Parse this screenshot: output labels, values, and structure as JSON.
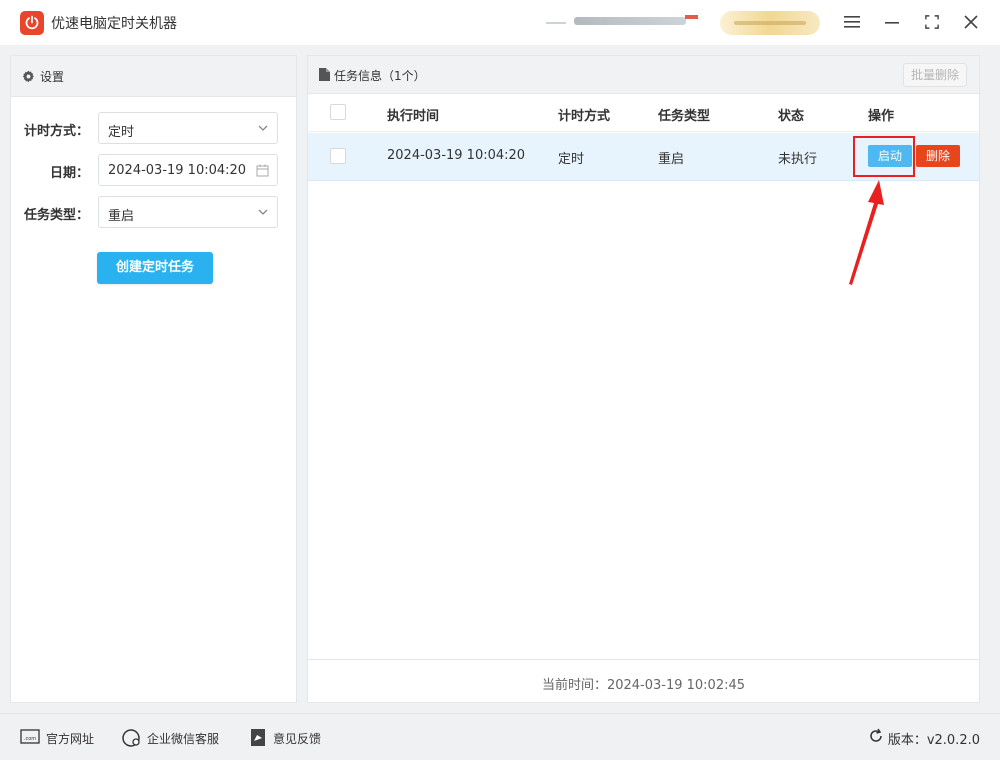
{
  "app": {
    "title": "优速电脑定时关机器"
  },
  "colors": {
    "accent": "#2ab1f0",
    "danger": "#e8451d",
    "highlight": "#e8201e",
    "logo": "#e8452c"
  },
  "settings": {
    "title": "设置",
    "timing_label": "计时方式：",
    "timing_value": "定时",
    "date_label": "日期：",
    "date_value": "2024-03-19 10:04:20",
    "task_type_label": "任务类型：",
    "task_type_value": "重启",
    "create_button": "创建定时任务"
  },
  "tasks": {
    "title": "任务信息（1个）",
    "batch_delete": "批量删除",
    "columns": [
      "执行时间",
      "计时方式",
      "任务类型",
      "状态",
      "操作"
    ],
    "rows": [
      {
        "time": "2024-03-19 10:04:20",
        "mode": "定时",
        "type": "重启",
        "status": "未执行",
        "start": "启动",
        "delete": "删除"
      }
    ],
    "current_time_label": "当前时间：2024-03-19 10:02:45"
  },
  "footer": {
    "website": "官方网址",
    "wechat": "企业微信客服",
    "feedback": "意见反馈",
    "version": "版本：v2.0.2.0"
  }
}
